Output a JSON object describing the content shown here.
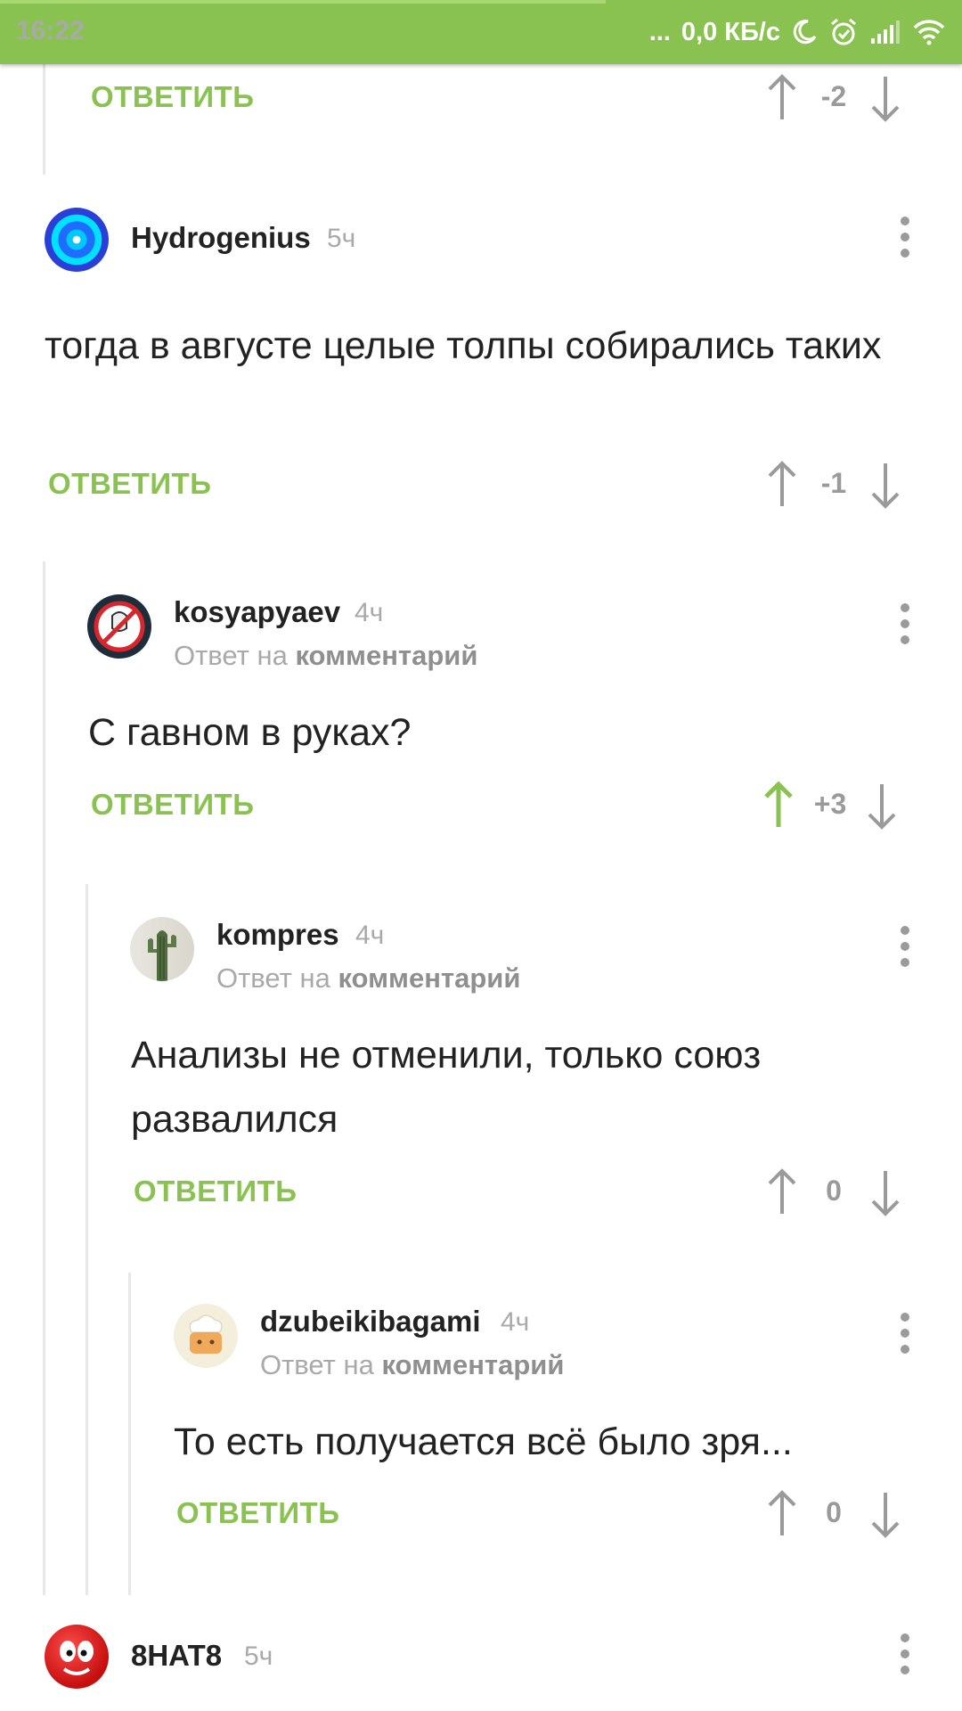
{
  "status_bar": {
    "time": "16:22",
    "dots": "...",
    "net_speed": "0,0 КБ/с",
    "icons": [
      "moon-icon",
      "alarm-icon",
      "signal-icon",
      "wifi-icon"
    ],
    "accent": "#8ac251"
  },
  "ui": {
    "reply_label": "ОТВЕТИТЬ",
    "reply_to_prefix": "Ответ на",
    "reply_to_link": "комментарий",
    "accent_color": "#8ac251",
    "muted_color": "#a9a9a9"
  },
  "top_fragment": {
    "score": "-2"
  },
  "comments": [
    {
      "username": "Hydrogenius",
      "time": "5ч",
      "text": "тогда в августе целые толпы собирались таких",
      "score": "-1",
      "avatar": "target-avatar"
    },
    {
      "username": "kosyapyaev",
      "time": "4ч",
      "text": "С гавном в руках?",
      "score": "+3",
      "upvoted": true,
      "avatar": "ghostbusters-avatar"
    },
    {
      "username": "kompres",
      "time": "4ч",
      "text": "Анализы не отменили, только союз развалился",
      "score": "0",
      "avatar": "cactus-avatar"
    },
    {
      "username": "dzubeikibagami",
      "time": "4ч",
      "text": "То есть получается всё было зря...",
      "score": "0",
      "avatar": "chef-avatar"
    },
    {
      "username": "8HAT8",
      "time": "5ч",
      "avatar": "red-face-avatar"
    }
  ]
}
